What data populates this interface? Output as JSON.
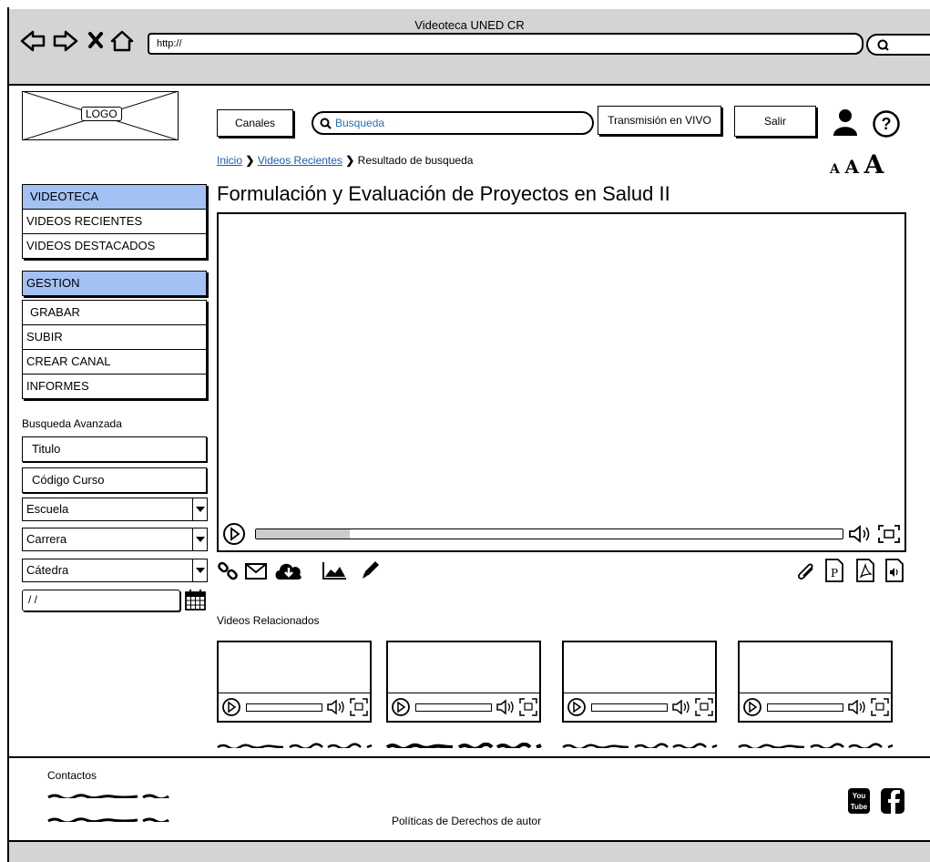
{
  "window": {
    "title": "Videoteca UNED CR"
  },
  "browser": {
    "url": "http://"
  },
  "header": {
    "logo": "LOGO",
    "channels_button": "Canales",
    "search_placeholder": "Busqueda",
    "live_button": "Transmisión en VIVO",
    "logout_button": "Salir",
    "font_sizes": [
      "A",
      "A",
      "A"
    ]
  },
  "breadcrumb": {
    "items": [
      "Inicio",
      "Videos Recientes",
      "Resultado de busqueda"
    ]
  },
  "page_title": "Formulación y Evaluación de Proyectos en Salud II",
  "sidebar": {
    "videoteca_header": "VIDEOTECA",
    "videoteca_items": [
      "VIDEOS RECIENTES",
      "VIDEOS DESTACADOS"
    ],
    "gestion_header": "GESTION",
    "gestion_items": [
      "GRABAR",
      "SUBIR",
      "CREAR CANAL",
      "INFORMES"
    ]
  },
  "advanced_search": {
    "heading": "Busqueda Avanzada",
    "title_field": "Titulo",
    "course_code_field": "Código Curso",
    "school_select": "Escuela",
    "career_select": "Carrera",
    "chair_select": "Cátedra",
    "date_field": "/ /"
  },
  "player": {
    "progress": 0.16
  },
  "related": {
    "heading": "Videos Relacionados",
    "count": 4
  },
  "footer": {
    "contacts_heading": "Contactos",
    "copyright": "Políticas de Derechos de autor"
  },
  "colors": {
    "sidebar_header": "#a3c1f2",
    "link": "#1c5fad",
    "chrome": "#d4d4d4"
  }
}
